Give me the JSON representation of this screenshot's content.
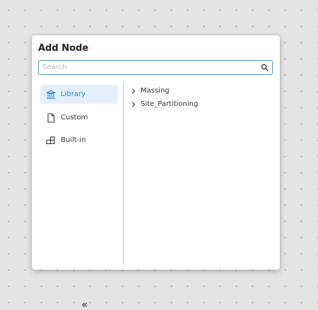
{
  "dialog": {
    "title": "Add Node",
    "search": {
      "placeholder": "Search",
      "value": "",
      "icon": "search-icon"
    },
    "sidebar": {
      "items": [
        {
          "label": "Library",
          "icon": "library-icon",
          "active": true
        },
        {
          "label": "Custom",
          "icon": "document-icon",
          "active": false
        },
        {
          "label": "Built-in",
          "icon": "blocks-icon",
          "active": false
        }
      ],
      "collapse_label": "«"
    },
    "tree": {
      "items": [
        {
          "label": "Massing",
          "icon": "chevron-right-icon"
        },
        {
          "label": "Site_Partitioning",
          "icon": "chevron-right-icon"
        }
      ]
    }
  },
  "colors": {
    "accent": "#2f7fd6",
    "active_bg": "#e3f0fc",
    "search_border": "#4a90d9",
    "canvas_bg": "#e4e4e4"
  }
}
